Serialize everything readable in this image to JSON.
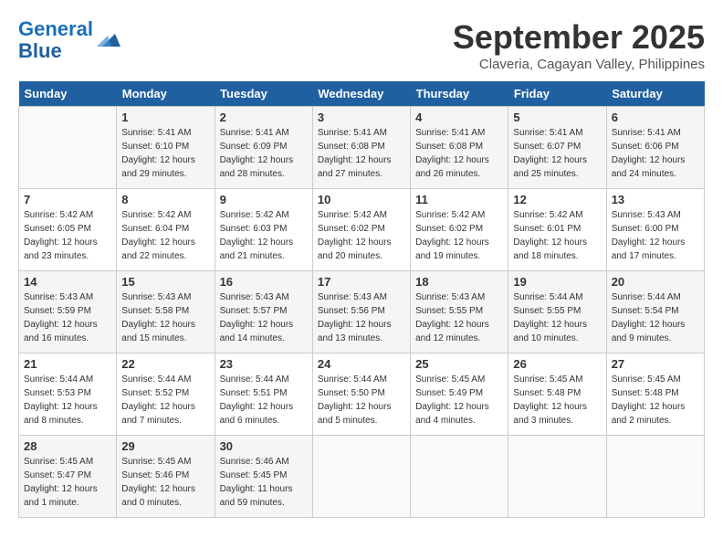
{
  "header": {
    "logo_line1": "General",
    "logo_line2": "Blue",
    "month": "September 2025",
    "location": "Claveria, Cagayan Valley, Philippines"
  },
  "weekdays": [
    "Sunday",
    "Monday",
    "Tuesday",
    "Wednesday",
    "Thursday",
    "Friday",
    "Saturday"
  ],
  "weeks": [
    [
      {
        "day": "",
        "info": ""
      },
      {
        "day": "1",
        "info": "Sunrise: 5:41 AM\nSunset: 6:10 PM\nDaylight: 12 hours\nand 29 minutes."
      },
      {
        "day": "2",
        "info": "Sunrise: 5:41 AM\nSunset: 6:09 PM\nDaylight: 12 hours\nand 28 minutes."
      },
      {
        "day": "3",
        "info": "Sunrise: 5:41 AM\nSunset: 6:08 PM\nDaylight: 12 hours\nand 27 minutes."
      },
      {
        "day": "4",
        "info": "Sunrise: 5:41 AM\nSunset: 6:08 PM\nDaylight: 12 hours\nand 26 minutes."
      },
      {
        "day": "5",
        "info": "Sunrise: 5:41 AM\nSunset: 6:07 PM\nDaylight: 12 hours\nand 25 minutes."
      },
      {
        "day": "6",
        "info": "Sunrise: 5:41 AM\nSunset: 6:06 PM\nDaylight: 12 hours\nand 24 minutes."
      }
    ],
    [
      {
        "day": "7",
        "info": "Sunrise: 5:42 AM\nSunset: 6:05 PM\nDaylight: 12 hours\nand 23 minutes."
      },
      {
        "day": "8",
        "info": "Sunrise: 5:42 AM\nSunset: 6:04 PM\nDaylight: 12 hours\nand 22 minutes."
      },
      {
        "day": "9",
        "info": "Sunrise: 5:42 AM\nSunset: 6:03 PM\nDaylight: 12 hours\nand 21 minutes."
      },
      {
        "day": "10",
        "info": "Sunrise: 5:42 AM\nSunset: 6:02 PM\nDaylight: 12 hours\nand 20 minutes."
      },
      {
        "day": "11",
        "info": "Sunrise: 5:42 AM\nSunset: 6:02 PM\nDaylight: 12 hours\nand 19 minutes."
      },
      {
        "day": "12",
        "info": "Sunrise: 5:42 AM\nSunset: 6:01 PM\nDaylight: 12 hours\nand 18 minutes."
      },
      {
        "day": "13",
        "info": "Sunrise: 5:43 AM\nSunset: 6:00 PM\nDaylight: 12 hours\nand 17 minutes."
      }
    ],
    [
      {
        "day": "14",
        "info": "Sunrise: 5:43 AM\nSunset: 5:59 PM\nDaylight: 12 hours\nand 16 minutes."
      },
      {
        "day": "15",
        "info": "Sunrise: 5:43 AM\nSunset: 5:58 PM\nDaylight: 12 hours\nand 15 minutes."
      },
      {
        "day": "16",
        "info": "Sunrise: 5:43 AM\nSunset: 5:57 PM\nDaylight: 12 hours\nand 14 minutes."
      },
      {
        "day": "17",
        "info": "Sunrise: 5:43 AM\nSunset: 5:56 PM\nDaylight: 12 hours\nand 13 minutes."
      },
      {
        "day": "18",
        "info": "Sunrise: 5:43 AM\nSunset: 5:55 PM\nDaylight: 12 hours\nand 12 minutes."
      },
      {
        "day": "19",
        "info": "Sunrise: 5:44 AM\nSunset: 5:55 PM\nDaylight: 12 hours\nand 10 minutes."
      },
      {
        "day": "20",
        "info": "Sunrise: 5:44 AM\nSunset: 5:54 PM\nDaylight: 12 hours\nand 9 minutes."
      }
    ],
    [
      {
        "day": "21",
        "info": "Sunrise: 5:44 AM\nSunset: 5:53 PM\nDaylight: 12 hours\nand 8 minutes."
      },
      {
        "day": "22",
        "info": "Sunrise: 5:44 AM\nSunset: 5:52 PM\nDaylight: 12 hours\nand 7 minutes."
      },
      {
        "day": "23",
        "info": "Sunrise: 5:44 AM\nSunset: 5:51 PM\nDaylight: 12 hours\nand 6 minutes."
      },
      {
        "day": "24",
        "info": "Sunrise: 5:44 AM\nSunset: 5:50 PM\nDaylight: 12 hours\nand 5 minutes."
      },
      {
        "day": "25",
        "info": "Sunrise: 5:45 AM\nSunset: 5:49 PM\nDaylight: 12 hours\nand 4 minutes."
      },
      {
        "day": "26",
        "info": "Sunrise: 5:45 AM\nSunset: 5:48 PM\nDaylight: 12 hours\nand 3 minutes."
      },
      {
        "day": "27",
        "info": "Sunrise: 5:45 AM\nSunset: 5:48 PM\nDaylight: 12 hours\nand 2 minutes."
      }
    ],
    [
      {
        "day": "28",
        "info": "Sunrise: 5:45 AM\nSunset: 5:47 PM\nDaylight: 12 hours\nand 1 minute."
      },
      {
        "day": "29",
        "info": "Sunrise: 5:45 AM\nSunset: 5:46 PM\nDaylight: 12 hours\nand 0 minutes."
      },
      {
        "day": "30",
        "info": "Sunrise: 5:46 AM\nSunset: 5:45 PM\nDaylight: 11 hours\nand 59 minutes."
      },
      {
        "day": "",
        "info": ""
      },
      {
        "day": "",
        "info": ""
      },
      {
        "day": "",
        "info": ""
      },
      {
        "day": "",
        "info": ""
      }
    ]
  ]
}
